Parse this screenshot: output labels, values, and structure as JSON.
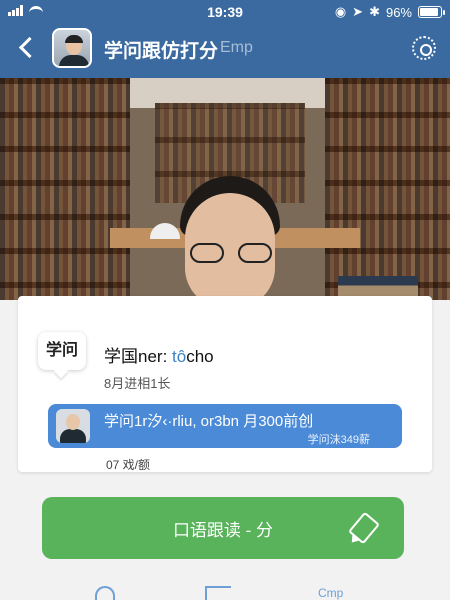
{
  "status_bar": {
    "time": "19:39",
    "battery": "96%",
    "battery_level": 0.96
  },
  "header": {
    "title": "学问跟仿打分",
    "subtitle": "Emp",
    "back_icon": "chevron-left-icon",
    "settings_icon": "gear-icon"
  },
  "lesson": {
    "tag": "学问",
    "line_prefix": "学国ner:",
    "line_highlight": "tô",
    "line_suffix": "cho",
    "meta": "8月进相1长",
    "pill_text": "学问1r汐‹·rliu, or3bn 月300前创",
    "pill_small": "学问沫349薪",
    "footer": "07  戏/额"
  },
  "action": {
    "label": "口语跟读 - 分",
    "icon": "pencil-icon"
  },
  "tabbar": {
    "third_label": "Cmp"
  },
  "colors": {
    "header_bg": "#3a6aa0",
    "pill_bg": "#4a8ad7",
    "button_bg": "#58b35a",
    "highlight": "#3b82c6"
  }
}
